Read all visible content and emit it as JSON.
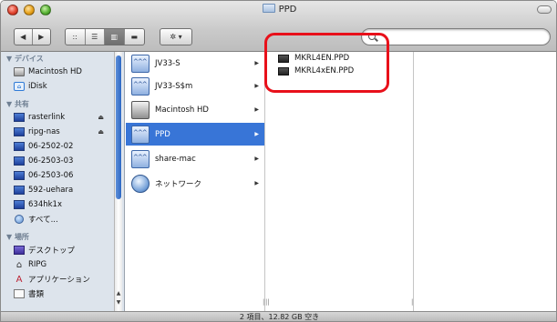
{
  "window": {
    "title": "PPD"
  },
  "toolbar": {
    "back": "◀",
    "forward": "▶",
    "view_icon": "::",
    "view_list": "☰",
    "view_column": "▥",
    "view_coverflow": "▬",
    "action": "✲ ▾",
    "search_placeholder": ""
  },
  "sidebar": {
    "devices_header": "▼ デバイス",
    "devices": [
      {
        "label": "Macintosh HD",
        "icon": "harddisk-icon"
      },
      {
        "label": "iDisk",
        "icon": "idisk-icon"
      }
    ],
    "shared_header": "▼ 共有",
    "shared": [
      {
        "label": "rasterlink",
        "eject": "⏏"
      },
      {
        "label": "ripg-nas",
        "eject": "⏏"
      },
      {
        "label": "06-2502-02"
      },
      {
        "label": "06-2503-03"
      },
      {
        "label": "06-2503-06"
      },
      {
        "label": "592-uehara"
      },
      {
        "label": "634hk1x"
      },
      {
        "label": "すべて..."
      }
    ],
    "places_header": "▼ 場所",
    "places": [
      {
        "label": "デスクトップ",
        "icon": "desktop-icon"
      },
      {
        "label": "RIPG",
        "icon": "home-icon"
      },
      {
        "label": "アプリケーション",
        "icon": "applications-icon"
      },
      {
        "label": "書類",
        "icon": "documents-icon"
      }
    ]
  },
  "column1": {
    "items": [
      {
        "label": "JV33-S"
      },
      {
        "label": "JV33-S$m"
      },
      {
        "label": "Macintosh HD"
      },
      {
        "label": "PPD"
      },
      {
        "label": "share-mac"
      },
      {
        "label": "ネットワーク"
      }
    ]
  },
  "column2": {
    "items": [
      {
        "label": "MKRL4EN.PPD"
      },
      {
        "label": "MKRL4xEN.PPD"
      }
    ]
  },
  "status": {
    "text": "2 項目、12.82 GB 空き"
  },
  "colors": {
    "selection": "#3875d7",
    "highlight_ring": "#e8101a"
  }
}
